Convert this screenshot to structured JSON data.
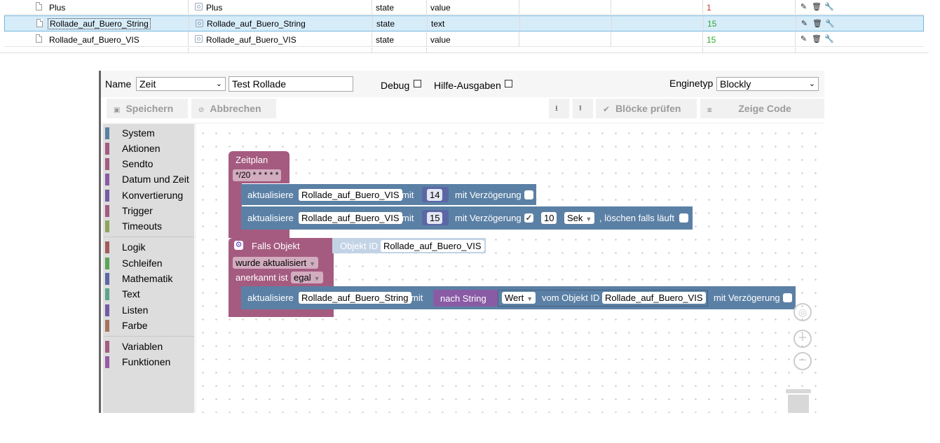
{
  "table": {
    "rows": [
      {
        "name": "Plus",
        "state_name": "Plus",
        "type": "state",
        "role": "value",
        "val": "1",
        "val_color": "red"
      },
      {
        "name": "Rollade_auf_Buero_String",
        "state_name": "Rollade_auf_Buero_String",
        "type": "state",
        "role": "text",
        "val": "15",
        "val_color": "green"
      },
      {
        "name": "Rollade_auf_Buero_VIS",
        "state_name": "Rollade_auf_Buero_VIS",
        "type": "state",
        "role": "value",
        "val": "15",
        "val_color": "green"
      }
    ],
    "actions": {
      "edit": "✎",
      "delete": "🗑",
      "settings": "🔧"
    }
  },
  "editor": {
    "name_label": "Name",
    "folder_select": "Zeit",
    "script_name": "Test Rollade",
    "debug_label": "Debug",
    "help_label": "Hilfe-Ausgaben",
    "engine_label": "Enginetyp",
    "engine_select": "Blockly",
    "save_btn": "Speichern",
    "cancel_btn": "Abbrechen",
    "export_btn": "⭳",
    "import_btn": "⭱",
    "check_btn": "Blöcke prüfen",
    "code_btn": "Zeige Code"
  },
  "toolbox": {
    "categories": [
      {
        "label": "System",
        "color": "#5b80a5"
      },
      {
        "label": "Aktionen",
        "color": "#a55b80"
      },
      {
        "label": "Sendto",
        "color": "#a55b80"
      },
      {
        "label": "Datum und Zeit",
        "color": "#a55ba5"
      },
      {
        "label": "Konvertierung",
        "color": "#745ba5"
      },
      {
        "label": "Trigger",
        "color": "#a55b80"
      },
      {
        "label": "Timeouts",
        "color": "#a5a55b"
      },
      {
        "label": "Logik",
        "color": "#a55b5b"
      },
      {
        "label": "Schleifen",
        "color": "#5ba55b"
      },
      {
        "label": "Mathematik",
        "color": "#5b67a5"
      },
      {
        "label": "Text",
        "color": "#5ba58c"
      },
      {
        "label": "Listen",
        "color": "#745ba5"
      },
      {
        "label": "Farbe",
        "color": "#a5745b"
      },
      {
        "label": "Variablen",
        "color": "#a55b80"
      },
      {
        "label": "Funktionen",
        "color": "#995ba5"
      }
    ]
  },
  "blocks": {
    "schedule": {
      "title": "Zeitplan",
      "cron": "*/20 * * * * *"
    },
    "update1": {
      "label": "aktualisiere",
      "obj": "Rollade_auf_Buero_VIS",
      "mit": "mit",
      "value": "14",
      "delay": "mit Verzögerung"
    },
    "update2": {
      "label": "aktualisiere",
      "obj": "Rollade_auf_Buero_VIS",
      "mit": "mit",
      "value": "15",
      "delay": "mit Verzögerung",
      "delay_checked": "✓",
      "delay_value": "10",
      "unit": "Sek",
      "clear": ", löschen falls läuft"
    },
    "trigger": {
      "title": "Falls Objekt",
      "objid_label": "Objekt ID",
      "objid": "Rollade_auf_Buero_VIS",
      "event": "wurde aktualisiert",
      "ack_label": "anerkannt ist",
      "ack": "egal"
    },
    "update3": {
      "label": "aktualisiere",
      "obj": "Rollade_auf_Buero_String",
      "mit": "mit",
      "convert": "nach String",
      "prop": "Wert",
      "of_obj": "vom Objekt ID",
      "src": "Rollade_auf_Buero_VIS",
      "delay": "mit Verzögerung"
    }
  }
}
